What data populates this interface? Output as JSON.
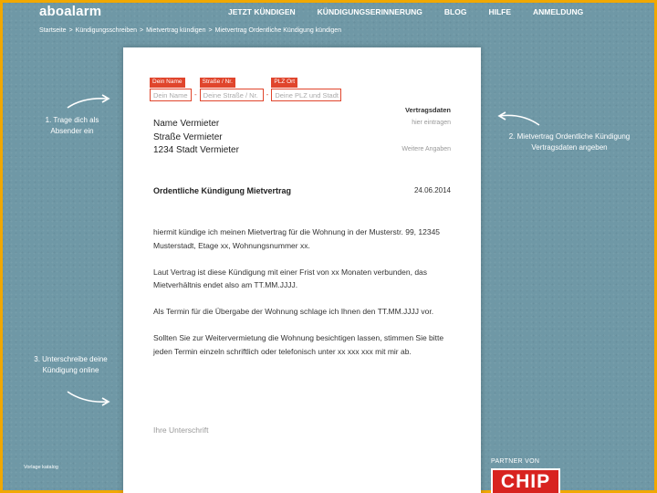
{
  "header": {
    "logo": "aboalarm",
    "nav": [
      "JETZT KÜNDIGEN",
      "KÜNDIGUNGSERINNERUNG",
      "BLOG",
      "HILFE",
      "ANMELDUNG"
    ]
  },
  "breadcrumbs": [
    "Startseite",
    "Kündigungsschreiben",
    "Mietvertrag kündigen",
    "Mietvertrag Ordentliche Kündigung kündigen"
  ],
  "sender": {
    "name_tag": "Dein Name",
    "name_placeholder": "Dein Name",
    "street_tag": "Straße / Nr.",
    "street_placeholder": "Deine Straße / Nr.",
    "zip_tag": "PLZ Ort",
    "zip_placeholder": "Deine PLZ und Stadt",
    "separator": "-"
  },
  "meta": {
    "heading": "Vertragsdaten",
    "hint1": "hier eintragen",
    "hint2": "Weitere Angaben"
  },
  "recipient": {
    "line1": "Name Vermieter",
    "line2": "Straße Vermieter",
    "line3": "1234 Stadt Vermieter"
  },
  "letter": {
    "subject": "Ordentliche Kündigung Mietvertrag",
    "date": "24.06.2014",
    "paragraphs": [
      "hiermit kündige ich meinen Mietvertrag für die Wohnung in der Musterstr. 99, 12345 Musterstadt, Etage xx, Wohnungsnummer xx.",
      "Laut Vertrag ist diese Kündigung mit einer Frist von xx Monaten verbunden, das Mietverhältnis endet also am TT.MM.JJJJ.",
      "Als Termin für die Übergabe der Wohnung schlage ich Ihnen den TT.MM.JJJJ vor.",
      "Sollten Sie zur Weitervermietung die Wohnung besichtigen lassen, stimmen Sie bitte jeden Termin einzeln schriftlich oder telefonisch unter xx xxx xxx mit mir ab."
    ],
    "signature": "Ihre Unterschrift"
  },
  "hints": {
    "step1": "1. Trage dich als Absender ein",
    "step2": "2. Mietvertrag Ordentliche Kündigung Vertragsdaten angeben",
    "step3": "3. Unterschreibe deine Kündigung online"
  },
  "footer": {
    "link": "Vorlage katalog",
    "partner": "PARTNER VON",
    "partner_logo": "CHIP"
  },
  "colors": {
    "background": "#6f98a6",
    "accent": "#e0452c",
    "border": "#f1a800",
    "chip_red": "#d8231f"
  }
}
